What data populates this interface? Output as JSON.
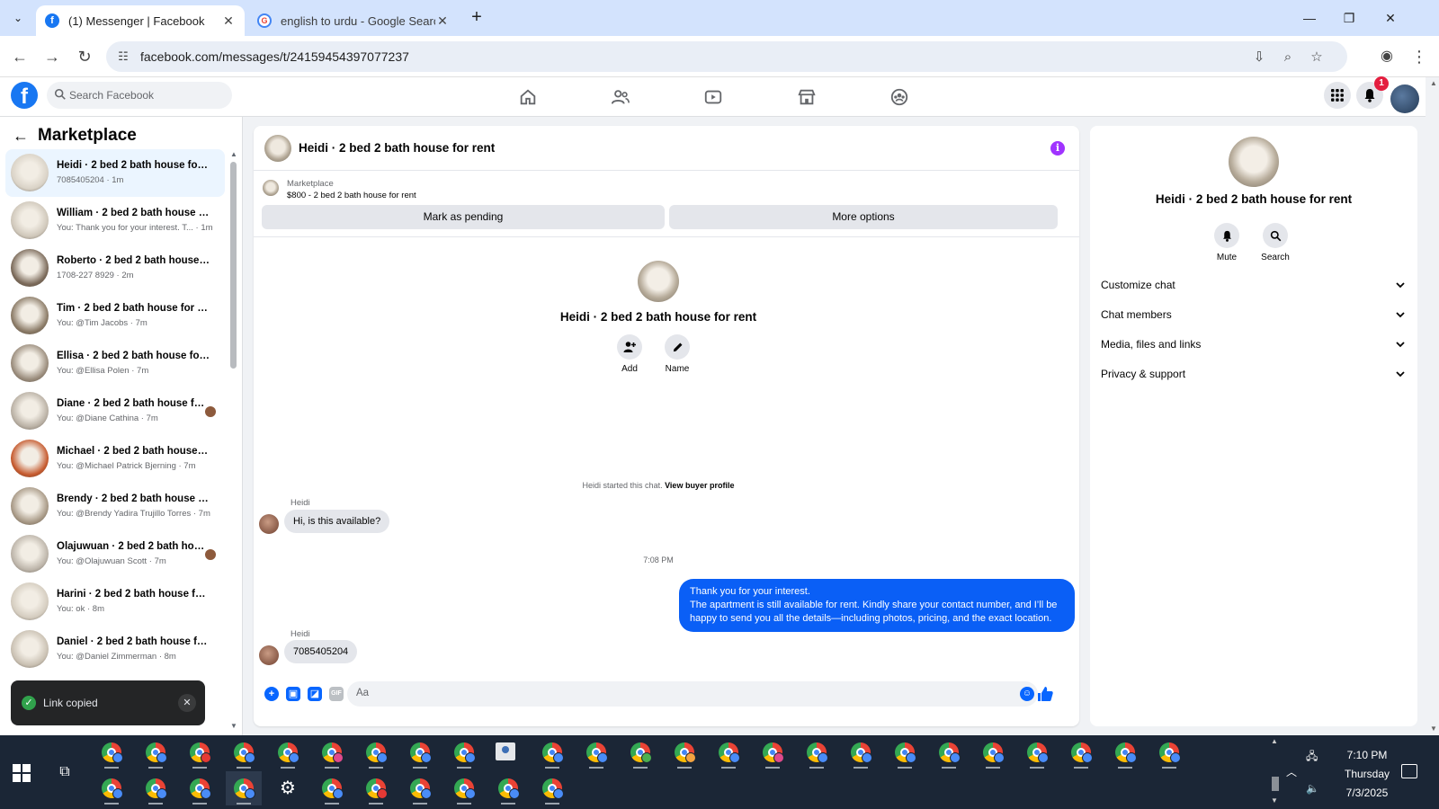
{
  "browser": {
    "tabs": [
      {
        "title": "(1) Messenger | Facebook",
        "favicon": "facebook-icon",
        "active": true
      },
      {
        "title": "english to urdu - Google Search",
        "favicon": "google-icon",
        "active": false
      }
    ],
    "url": "facebook.com/messages/t/24159454397077237"
  },
  "facebook": {
    "search_placeholder": "Search Facebook",
    "notification_count": "1",
    "brand_color": "#1877f2"
  },
  "sidebar": {
    "title": "Marketplace",
    "chats": [
      {
        "name": "Heidi · 2 bed 2 bath house for rent",
        "preview": "7085405204 · 1m",
        "selected": true,
        "thumb": "#d9d2c6"
      },
      {
        "name": "William · 2 bed 2 bath house for rent",
        "preview": "You: Thank you for your interest. T... · 1m",
        "thumb": "#cfc7ba"
      },
      {
        "name": "Roberto · 2 bed 2 bath house for rent",
        "preview": "1708-227 8929 · 2m",
        "thumb": "#7b6a5a"
      },
      {
        "name": "Tim · 2 bed 2 bath house for rent",
        "preview": "You: @Tim Jacobs · 7m",
        "thumb": "#8a7a66"
      },
      {
        "name": "Ellisa · 2 bed 2 bath house for rent",
        "preview": "You: @Ellisa Polen · 7m",
        "thumb": "#9a8c7c"
      },
      {
        "name": "Diane · 2 bed 2 bath house for rent",
        "preview": "You: @Diane Cathina · 7m",
        "thumb": "#b9b0a4"
      },
      {
        "name": "Michael · 2 bed 2 bath house for rent",
        "preview": "You: @Michael Patrick Bjerning · 7m",
        "thumb": "#c65a2e"
      },
      {
        "name": "Brendy · 2 bed 2 bath house for rent",
        "preview": "You: @Brendy Yadira Trujillo Torres · 7m",
        "thumb": "#a79885"
      },
      {
        "name": "Olajuwuan · 2 bed 2 bath house for rent",
        "preview": "You: @Olajuwuan Scott · 7m",
        "thumb": "#bcb4a9"
      },
      {
        "name": "Harini · 2 bed 2 bath house for rent",
        "preview": "You: ok · 8m",
        "thumb": "#d4ccbf"
      },
      {
        "name": "Daniel · 2 bed 2 bath house for rent",
        "preview": "You: @Daniel Zimmerman · 8m",
        "thumb": "#c9c0b2"
      }
    ],
    "toast": "Link copied"
  },
  "conversation": {
    "title": "Heidi · 2 bed 2 bath house for rent",
    "marketplace_label": "Marketplace",
    "listing": "$800 - 2 bed 2 bath house for rent",
    "mark_pending": "Mark as pending",
    "more_options": "More options",
    "intro_actions": [
      {
        "label": "Add",
        "icon": "add-person-icon"
      },
      {
        "label": "Name",
        "icon": "pencil-icon"
      }
    ],
    "started_text": "Heidi started this chat.",
    "view_buyer": "View buyer profile",
    "sender": "Heidi",
    "msg1": "Hi, is this available?",
    "time": "7:08 PM",
    "reply_lines": [
      "Thank you for your interest.",
      "The apartment is still available for rent. Kindly share your contact number, and I’ll be",
      "happy to send you all the details—including photos, pricing, and the exact location."
    ],
    "msg2": "7085405204",
    "composer_placeholder": "Aa",
    "accent_color": "#0a5ff6"
  },
  "info_panel": {
    "title": "Heidi · 2 bed 2 bath house for rent",
    "actions": [
      {
        "label": "Mute",
        "icon": "bell-icon"
      },
      {
        "label": "Search",
        "icon": "search-icon"
      }
    ],
    "sections": [
      "Customize chat",
      "Chat members",
      "Media, files and links",
      "Privacy & support"
    ]
  },
  "taskbar": {
    "time": "7:10 PM",
    "day": "Thursday",
    "date": "7/3/2025"
  }
}
